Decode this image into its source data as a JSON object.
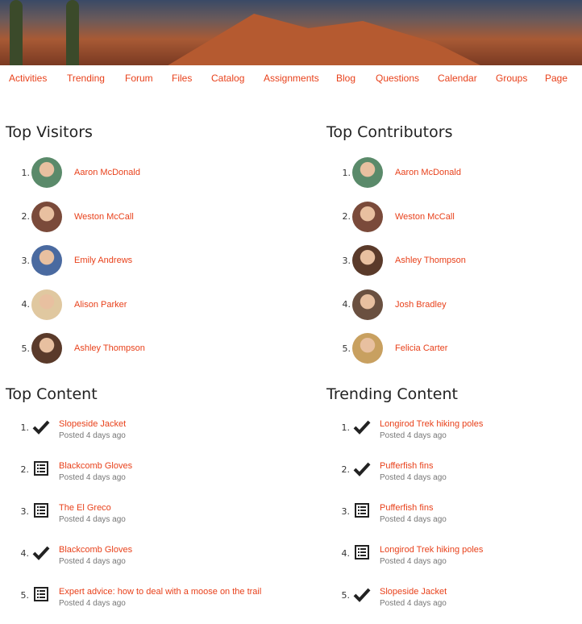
{
  "nav": [
    "Activities",
    "Trending",
    "Forum",
    "Files",
    "Catalog",
    "Assignments",
    "Blog",
    "Questions",
    "Calendar",
    "Groups",
    "Page"
  ],
  "top_visitors": {
    "title": "Top Visitors",
    "items": [
      {
        "name": "Aaron McDonald",
        "color": "#5a8a6a"
      },
      {
        "name": "Weston McCall",
        "color": "#7a4a3a"
      },
      {
        "name": "Emily Andrews",
        "color": "#4a6aa0"
      },
      {
        "name": "Alison Parker",
        "color": "#e0c8a0"
      },
      {
        "name": "Ashley Thompson",
        "color": "#5a3a2a"
      }
    ]
  },
  "top_contributors": {
    "title": "Top Contributors",
    "items": [
      {
        "name": "Aaron McDonald",
        "color": "#5a8a6a"
      },
      {
        "name": "Weston McCall",
        "color": "#7a4a3a"
      },
      {
        "name": "Ashley Thompson",
        "color": "#5a3a2a"
      },
      {
        "name": "Josh Bradley",
        "color": "#6a5040"
      },
      {
        "name": "Felicia Carter",
        "color": "#c8a060"
      }
    ]
  },
  "top_content": {
    "title": "Top Content",
    "items": [
      {
        "title": "Slopeside Jacket",
        "meta": "Posted 4 days ago",
        "icon": "check"
      },
      {
        "title": "Blackcomb Gloves",
        "meta": "Posted 4 days ago",
        "icon": "list"
      },
      {
        "title": "The El Greco",
        "meta": "Posted 4 days ago",
        "icon": "list"
      },
      {
        "title": "Blackcomb Gloves",
        "meta": "Posted 4 days ago",
        "icon": "check"
      },
      {
        "title": "Expert advice: how to deal with a moose on the trail",
        "meta": "Posted 4 days ago",
        "icon": "list"
      }
    ]
  },
  "trending_content": {
    "title": "Trending Content",
    "items": [
      {
        "title": "Longirod Trek hiking poles",
        "meta": "Posted 4 days ago",
        "icon": "check"
      },
      {
        "title": "Pufferfish fins",
        "meta": "Posted 4 days ago",
        "icon": "check"
      },
      {
        "title": "Pufferfish fins",
        "meta": "Posted 4 days ago",
        "icon": "list"
      },
      {
        "title": "Longirod Trek hiking poles",
        "meta": "Posted 4 days ago",
        "icon": "list"
      },
      {
        "title": "Slopeside Jacket",
        "meta": "Posted 4 days ago",
        "icon": "check"
      }
    ]
  }
}
